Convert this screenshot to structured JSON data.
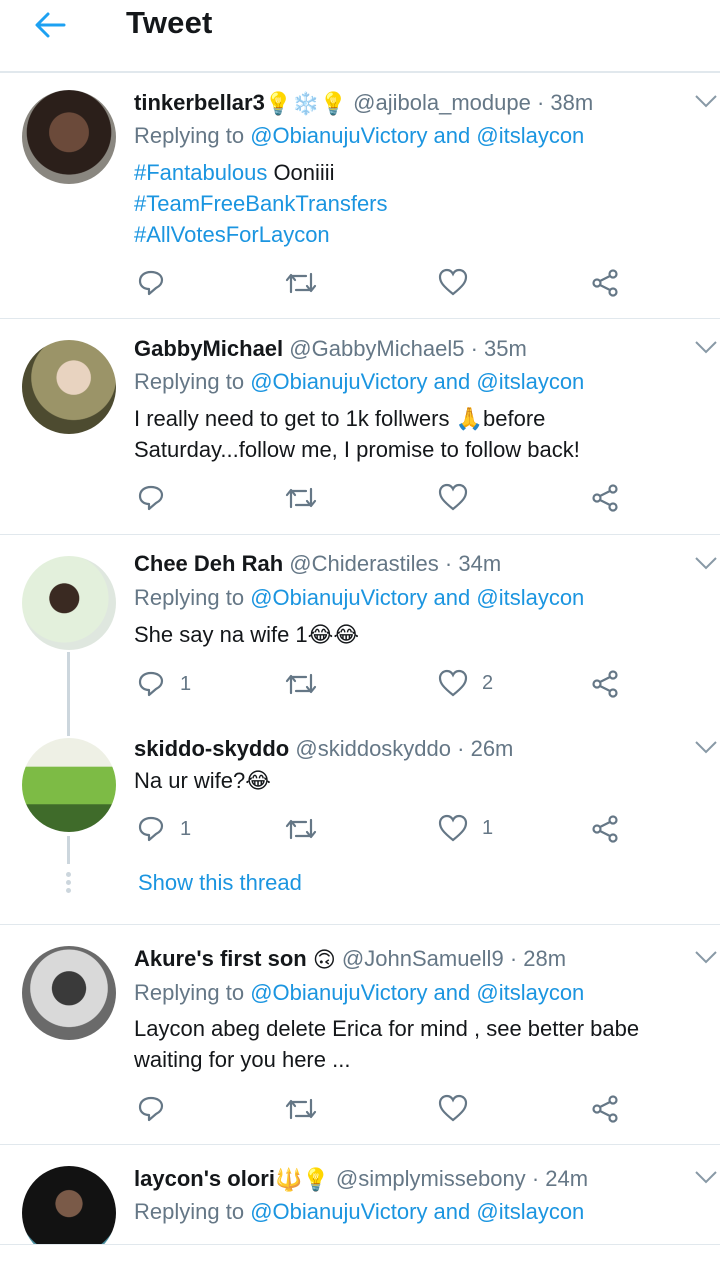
{
  "header": {
    "title": "Tweet"
  },
  "reply_prefix": "Replying to",
  "reply_targets": "@ObianujuVictory and @itslaycon",
  "show_thread": "Show this thread",
  "tweets": [
    {
      "name": "tinkerbellar3",
      "name_emojis": "💡❄️💡",
      "handle": "@ajibola_modupe",
      "time": "· 38m",
      "lines": [
        "#Fantabulous",
        " Ooniiii",
        "#TeamFreeBankTransfers",
        "#AllVotesForLaycon"
      ],
      "replies": "",
      "retweets": "",
      "likes": ""
    },
    {
      "name": "GabbyMichael",
      "handle": "@GabbyMichael5",
      "time": "· 35m",
      "lines": [
        "I really need to get to 1k follwers 🙏before",
        "Saturday...follow me, I promise to follow back!"
      ],
      "replies": "",
      "retweets": "",
      "likes": ""
    },
    {
      "name": "Chee Deh Rah",
      "handle": "@Chiderastiles",
      "time": "· 34m",
      "lines": [
        "She say na wife 1😂😂"
      ],
      "replies": "1",
      "retweets": "",
      "likes": "2"
    },
    {
      "name": "skiddo-skyddo",
      "handle": "@skiddoskyddo",
      "time": "· 26m",
      "lines": [
        "Na ur wife?😂"
      ],
      "replies": "1",
      "retweets": "",
      "likes": "1"
    },
    {
      "name": "Akure's first son",
      "name_emojis": "🙃",
      "handle": "@JohnSamuell9",
      "time": "· 28m",
      "lines": [
        "Laycon abeg delete Erica for mind , see better babe",
        "waiting for you here  ..."
      ],
      "replies": "",
      "retweets": "",
      "likes": ""
    },
    {
      "name": "laycon's olori",
      "name_emojis": "🔱💡",
      "handle": "@simplymissebony",
      "time": "· 24m",
      "lines": [],
      "replies": "",
      "retweets": "",
      "likes": ""
    }
  ],
  "colors": {
    "accent": "#1b95e0",
    "muted": "#657786",
    "text": "#14171a",
    "divider": "#e1e8ed"
  },
  "icons": [
    "back-arrow-icon",
    "chevron-down-icon",
    "reply-icon",
    "retweet-icon",
    "like-icon",
    "share-icon"
  ]
}
